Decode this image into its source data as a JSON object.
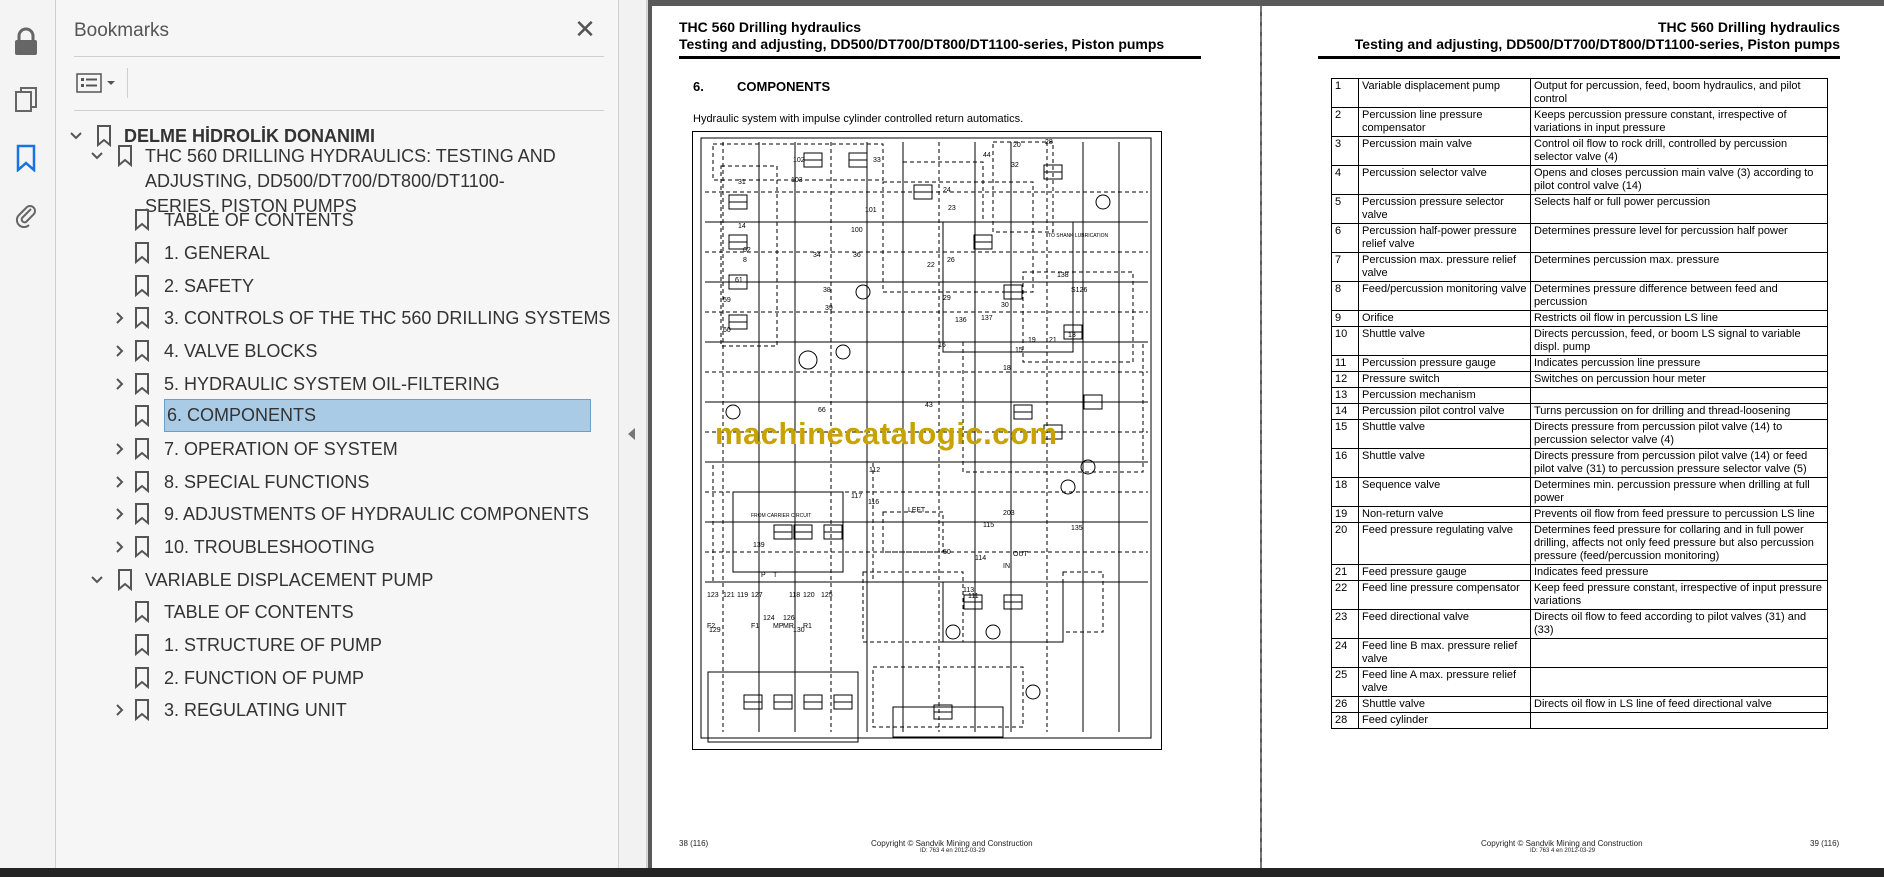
{
  "toolbar": {
    "icons": [
      "lock-icon",
      "copy-pages-icon",
      "bookmark-icon",
      "attachment-icon"
    ],
    "accent_color": "#1473e6"
  },
  "bookmarks_panel": {
    "title": "Bookmarks",
    "close_symbol": "✕",
    "items": [
      {
        "label": "DELME HİDROLİK DONANIMI",
        "level": 0,
        "expanded": true,
        "bold": true
      },
      {
        "label": "THC 560 DRILLING HYDRAULICS: TESTING AND ADJUSTING, DD500/DT700/DT800/DT1100-SERIES, PISTON PUMPS",
        "level": 1,
        "expanded": true
      },
      {
        "label": "TABLE OF CONTENTS",
        "level": 2
      },
      {
        "label": "1. GENERAL",
        "level": 2
      },
      {
        "label": "2. SAFETY",
        "level": 2
      },
      {
        "label": "3. CONTROLS OF THE THC 560 DRILLING SYSTEMS",
        "level": 2,
        "expanded": false
      },
      {
        "label": "4. VALVE BLOCKS",
        "level": 2,
        "expanded": false
      },
      {
        "label": "5. HYDRAULIC SYSTEM OIL-FILTERING",
        "level": 2,
        "expanded": false
      },
      {
        "label": "6. COMPONENTS",
        "level": 2,
        "selected": true
      },
      {
        "label": "7. OPERATION OF SYSTEM",
        "level": 2,
        "expanded": false
      },
      {
        "label": "8. SPECIAL FUNCTIONS",
        "level": 2,
        "expanded": false
      },
      {
        "label": "9. ADJUSTMENTS OF HYDRAULIC COMPONENTS",
        "level": 2,
        "expanded": false
      },
      {
        "label": "10. TROUBLESHOOTING",
        "level": 2,
        "expanded": false
      },
      {
        "label": "VARIABLE DISPLACEMENT PUMP",
        "level": 1,
        "expanded": true
      },
      {
        "label": "TABLE OF CONTENTS",
        "level": 2
      },
      {
        "label": "1. STRUCTURE OF PUMP",
        "level": 2
      },
      {
        "label": "2. FUNCTION OF PUMP",
        "level": 2
      },
      {
        "label": "3. REGULATING UNIT",
        "level": 2,
        "expanded": false
      }
    ]
  },
  "page_left": {
    "header_title": "THC 560 Drilling hydraulics",
    "header_subtitle": "Testing and adjusting, DD500/DT700/DT800/DT1100-series, Piston pumps",
    "section_number": "6.",
    "section_title": "COMPONENTS",
    "caption": "Hydraulic system with impulse cylinder controlled return automatics.",
    "diagram_labels": [
      "102",
      "33",
      "31",
      "14",
      "62",
      "8",
      "61",
      "103",
      "101",
      "100",
      "36",
      "34",
      "38",
      "39",
      "59",
      "60",
      "44",
      "20",
      "32",
      "24",
      "23",
      "22",
      "26",
      "28",
      "29",
      "30",
      "136",
      "137",
      "138",
      "S126",
      "21",
      "13",
      "16",
      "19",
      "15",
      "18",
      "43",
      "66",
      "112",
      "117",
      "116",
      "203",
      "115",
      "135",
      "139",
      "114",
      "50",
      "123",
      "121",
      "119",
      "127",
      "118",
      "120",
      "125",
      "124",
      "126",
      "129",
      "130",
      "113",
      "111",
      "TO SHANK LUBRICATION",
      "FROM CARRIER CIRCUIT",
      "LEFT",
      "MP",
      "MR",
      "R1",
      "F1",
      "F2",
      "P",
      "T",
      "OUT",
      "IN"
    ],
    "watermark": "machinecatalogic.com",
    "footer_page": "38 (116)",
    "footer_copyright": "Copyright © Sandvik Mining and Construction",
    "footer_id": "ID: 763 4 en 2012-03-29"
  },
  "page_right": {
    "header_title": "THC 560 Drilling hydraulics",
    "header_subtitle": "Testing and adjusting, DD500/DT700/DT800/DT1100-series, Piston pumps",
    "footer_copyright": "Copyright © Sandvik Mining and Construction",
    "footer_id": "ID: 763 4 en 2012-03-29",
    "footer_page": "39 (116)",
    "table": [
      [
        "1",
        "Variable displacement pump",
        "Output for percussion, feed, boom hydraulics, and pilot control"
      ],
      [
        "2",
        "Percussion line pressure compensator",
        "Keeps percussion pressure constant, irrespective of variations in input pressure"
      ],
      [
        "3",
        "Percussion main valve",
        "Control oil flow to rock drill, controlled by percussion selector valve (4)"
      ],
      [
        "4",
        "Percussion selector valve",
        "Opens and closes percussion main valve (3) according to pilot control valve (14)"
      ],
      [
        "5",
        "Percussion pressure selector valve",
        "Selects half or full power percussion"
      ],
      [
        "6",
        "Percussion half-power pressure relief valve",
        "Determines pressure level for percussion half power"
      ],
      [
        "7",
        "Percussion max. pressure relief valve",
        "Determines percussion max. pressure"
      ],
      [
        "8",
        "Feed/percussion monitoring valve",
        "Determines pressure difference between feed and percussion"
      ],
      [
        "9",
        "Orifice",
        "Restricts oil flow in percussion LS line"
      ],
      [
        "10",
        "Shuttle valve",
        "Directs percussion, feed, or boom LS signal to variable displ. pump"
      ],
      [
        "11",
        "Percussion pressure gauge",
        "Indicates percussion line pressure"
      ],
      [
        "12",
        "Pressure switch",
        "Switches on percussion hour meter"
      ],
      [
        "13",
        "Percussion mechanism",
        ""
      ],
      [
        "14",
        "Percussion pilot control valve",
        "Turns percussion on for drilling and thread-loosening"
      ],
      [
        "15",
        "Shuttle valve",
        "Directs pressure from percussion pilot valve (14) to percussion selector valve (4)"
      ],
      [
        "16",
        "Shuttle valve",
        "Directs pressure from percussion pilot valve (14) or feed pilot valve (31) to percussion pressure selector valve (5)"
      ],
      [
        "18",
        "Sequence valve",
        "Determines min. percussion pressure when drilling at full power"
      ],
      [
        "19",
        "Non-return valve",
        "Prevents oil flow from feed pressure to percussion LS line"
      ],
      [
        "20",
        "Feed pressure regulating valve",
        "Determines feed pressure for collaring and in full power drilling, affects not only feed pressure but also percussion pressure (feed/percussion monitoring)"
      ],
      [
        "21",
        "Feed pressure gauge",
        "Indicates feed pressure"
      ],
      [
        "22",
        "Feed line pressure compensator",
        "Keep feed pressure constant, irrespective of input pressure variations"
      ],
      [
        "23",
        "Feed directional valve",
        "Directs oil flow to feed according to pilot valves (31) and (33)"
      ],
      [
        "24",
        "Feed line B max. pressure relief valve",
        ""
      ],
      [
        "25",
        "Feed line A max. pressure relief valve",
        ""
      ],
      [
        "26",
        "Shuttle valve",
        "Directs oil flow in LS line of feed directional valve"
      ],
      [
        "28",
        "Feed cylinder",
        ""
      ]
    ]
  }
}
